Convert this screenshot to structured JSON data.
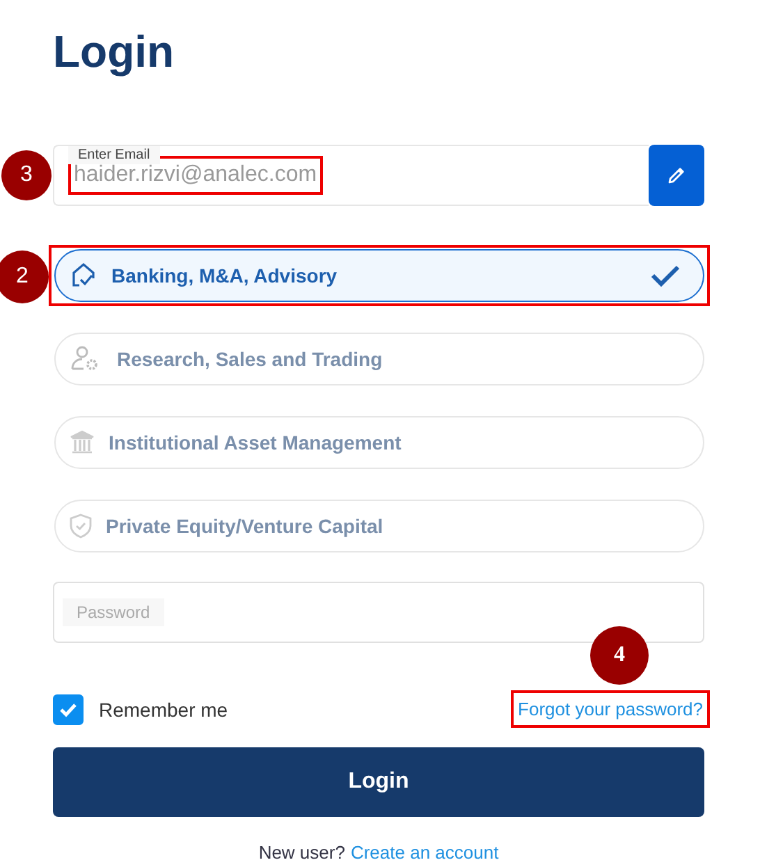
{
  "title": "Login",
  "email": {
    "label": "Enter Email",
    "value": "haider.rizvi@analec.com",
    "callout": "3"
  },
  "roles": [
    {
      "label": "Banking, M&A, Advisory",
      "selected": true,
      "kind": "banking",
      "callout": "2"
    },
    {
      "label": "Research, Sales and Trading",
      "selected": false,
      "kind": "research"
    },
    {
      "label": "Institutional Asset Management",
      "selected": false,
      "kind": "institution"
    },
    {
      "label": "Private Equity/Venture Capital",
      "selected": false,
      "kind": "equity"
    }
  ],
  "password": {
    "placeholder": "Password"
  },
  "remember": {
    "label": "Remember me",
    "checked": true
  },
  "forgot_link": {
    "label": "Forgot your password?",
    "callout": "4"
  },
  "login_button": "Login",
  "signup": {
    "prompt": "New user?",
    "link": "Create an account"
  }
}
